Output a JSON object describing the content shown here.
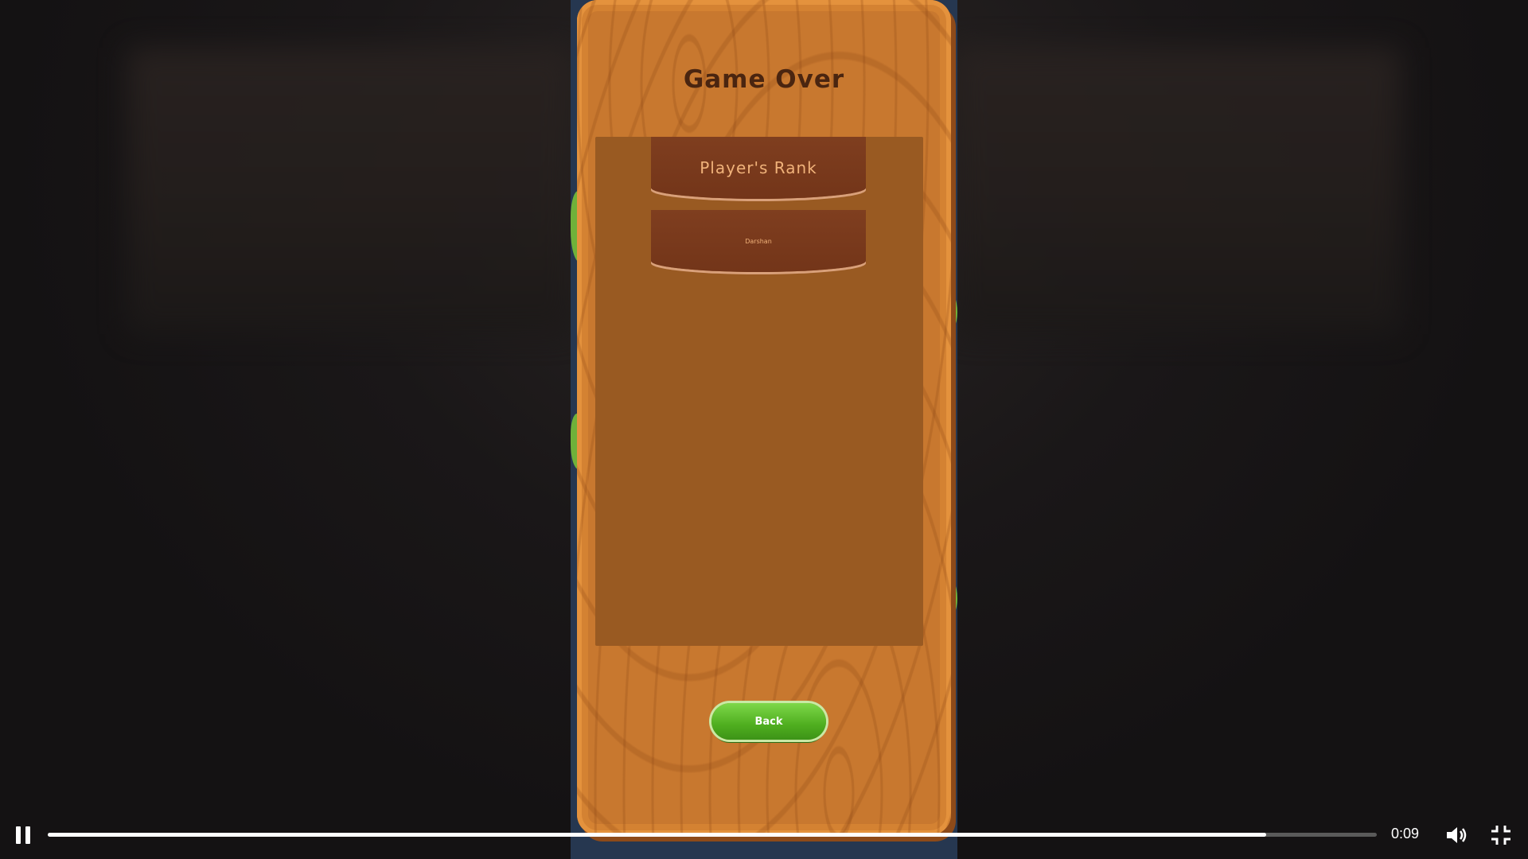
{
  "game": {
    "title": "Game Over",
    "rank_header": "Player's Rank",
    "players": [
      "Darshan"
    ],
    "back_label": "Back"
  },
  "video": {
    "time": "0:09",
    "progress": 0.917,
    "icons": {
      "play_pause": "pause-icon",
      "volume": "volume-icon",
      "fullscreen": "exit-fullscreen-icon"
    }
  }
}
